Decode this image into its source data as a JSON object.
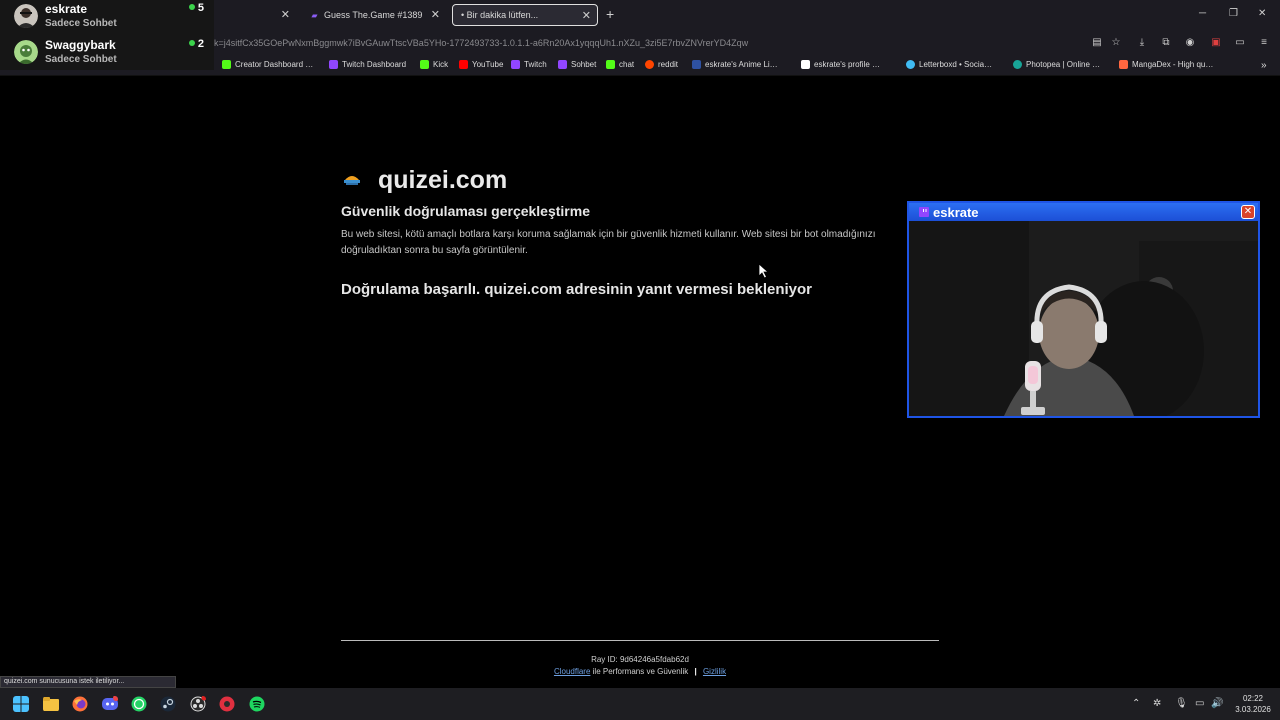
{
  "browser": {
    "tabs": [
      {
        "label": "",
        "active": false
      },
      {
        "label": "Guess The.Game #1389",
        "active": false
      },
      {
        "label": "• Bir dakika lütfen...",
        "active": true
      }
    ],
    "new_tab_label": "+",
    "url": "k=j4sitfCx35GOePwNxmBggmwk7iBvGAuwTtscVBa5YHo-1772493733-1.0.1.1-a6Rn20Ax1yqqqUh1.nXZu_3zi5E7rbvZNVrerYD4Zqw",
    "bookmarks": [
      {
        "label": "Creator Dashboard …",
        "color": "#53fc18"
      },
      {
        "label": "Twitch Dashboard",
        "color": "#9146ff"
      },
      {
        "label": "Kick",
        "color": "#53fc18"
      },
      {
        "label": "YouTube",
        "color": "#ff0000"
      },
      {
        "label": "Twitch",
        "color": "#9146ff"
      },
      {
        "label": "Sohbet",
        "color": "#9146ff"
      },
      {
        "label": "chat",
        "color": "#53fc18"
      },
      {
        "label": "reddit",
        "color": "#ff4500"
      },
      {
        "label": "eskrate's Anime Li…",
        "color": "#2e51a2"
      },
      {
        "label": "eskrate's profile …",
        "color": "#ffffff"
      },
      {
        "label": "Letterboxd • Socia…",
        "color": "#40bcf4"
      },
      {
        "label": "Photopea | Online …",
        "color": "#18a497"
      },
      {
        "label": "MangaDex - High qu…",
        "color": "#ff6740"
      }
    ]
  },
  "chat_overlay": {
    "users": [
      {
        "name": "eskrate",
        "sub": "Sadece Sohbet",
        "count": "5"
      },
      {
        "name": "Swaggybark",
        "sub": "Sadece Sohbet",
        "count": "2"
      }
    ]
  },
  "page": {
    "site_name": "quizei.com",
    "heading": "Güvenlik doğrulaması gerçekleştirme",
    "description": "Bu web sitesi, kötü amaçlı botlara karşı koruma sağlamak için bir güvenlik hizmeti kullanır. Web sitesi bir bot olmadığınızı doğruladıktan sonra bu sayfa görüntülenir.",
    "status": "Doğrulama başarılı. quizei.com adresinin yanıt vermesi bekleniyor",
    "ray_id": "Ray ID: 9d64246a5fdab62d",
    "footer_provider": "Cloudflare",
    "footer_middle": "ile Performans ve Güvenlik",
    "footer_separator": "|",
    "footer_privacy": "Gizlilik"
  },
  "cam_window": {
    "title": "eskrate",
    "close_label": "✕",
    "accent": "#1f55e6"
  },
  "status_tooltip": "quizei.com sunucusuna istek iletiliyor...",
  "taskbar": {
    "time": "02:22",
    "date": "3.03.2026",
    "discord_badge": "93"
  }
}
